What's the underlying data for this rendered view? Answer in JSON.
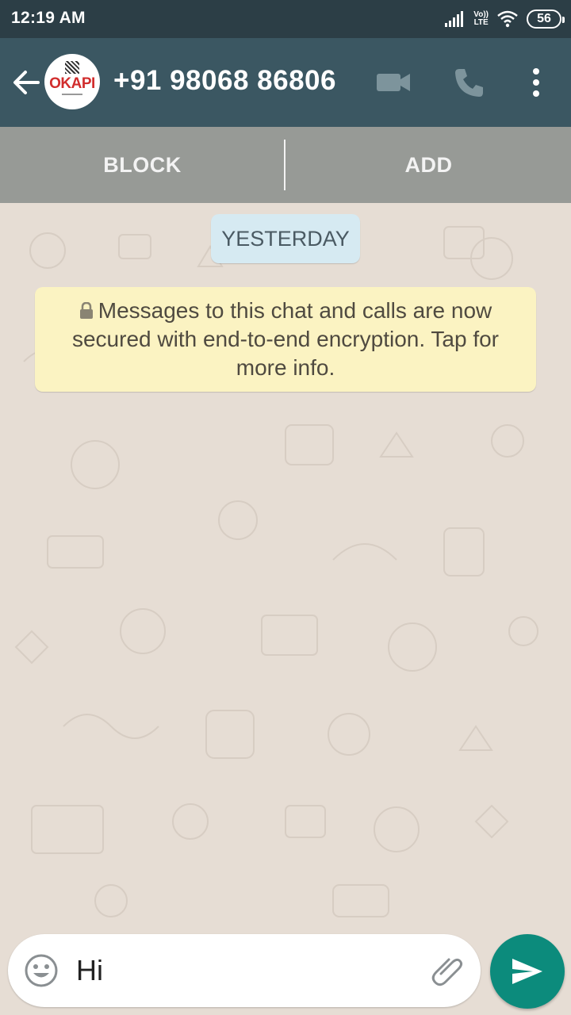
{
  "status_bar": {
    "time": "12:19 AM",
    "volte_top": "Vo))",
    "volte_bottom": "LTE",
    "battery": "56",
    "icons": [
      "signal-icon",
      "volte-icon",
      "wifi-icon",
      "battery-icon"
    ]
  },
  "header": {
    "contact": "+91 98068 86806",
    "avatar_text": "OKAPI",
    "icons": [
      "back-arrow-icon",
      "video-call-icon",
      "phone-call-icon",
      "more-options-icon"
    ]
  },
  "actions": {
    "block_label": "BLOCK",
    "add_label": "ADD"
  },
  "chat": {
    "date_label": "YESTERDAY",
    "encryption_notice": "Messages to this chat and calls are now secured with end-to-end encryption. Tap for more info."
  },
  "composer": {
    "value": "Hi",
    "icons": [
      "emoji-icon",
      "attach-icon",
      "send-icon"
    ]
  },
  "colors": {
    "status_bar": "#2c3e46",
    "app_bar": "#3b5762",
    "send_button": "#0c8b7c",
    "date_chip": "#d6eaf2",
    "notice_bubble": "#fbf3c2",
    "chat_background": "#e6ddd4"
  }
}
